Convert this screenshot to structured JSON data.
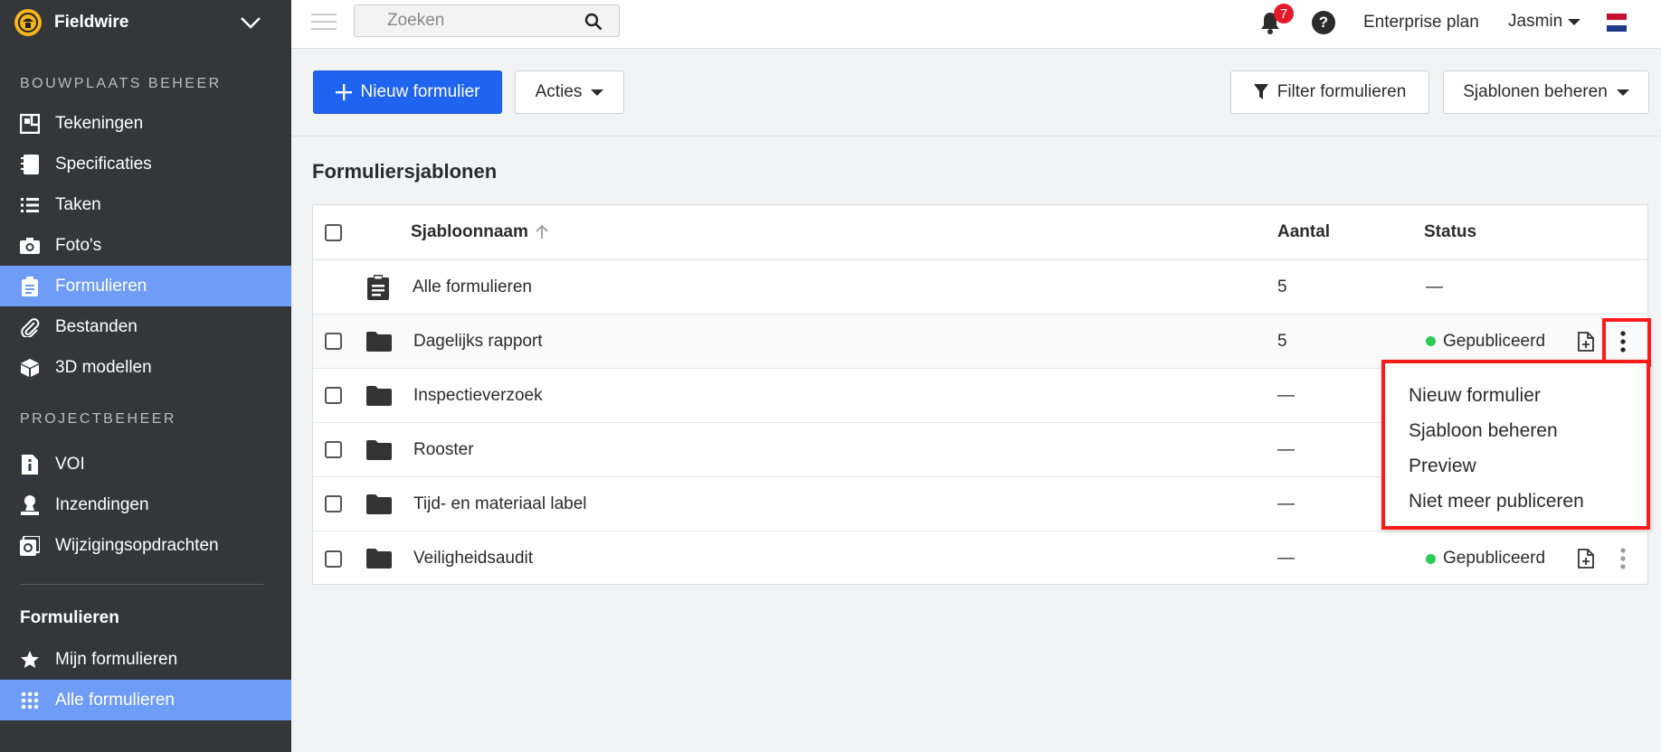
{
  "sidebar": {
    "brand": "Fieldwire",
    "section1_title": "BOUWPLAATS BEHEER",
    "section1_items": [
      {
        "label": "Tekeningen",
        "icon": "drawings-icon"
      },
      {
        "label": "Specificaties",
        "icon": "specs-icon"
      },
      {
        "label": "Taken",
        "icon": "tasks-list-icon"
      },
      {
        "label": "Foto's",
        "icon": "camera-icon"
      },
      {
        "label": "Formulieren",
        "icon": "clipboard-icon",
        "active": true
      },
      {
        "label": "Bestanden",
        "icon": "paperclip-icon"
      },
      {
        "label": "3D modellen",
        "icon": "cube-icon"
      }
    ],
    "section2_title": "PROJECTBEHEER",
    "section2_items": [
      {
        "label": "VOI",
        "icon": "rfi-file-icon"
      },
      {
        "label": "Inzendingen",
        "icon": "submittal-icon"
      },
      {
        "label": "Wijzigingsopdrachten",
        "icon": "change-order-icon"
      }
    ],
    "sub_title": "Formulieren",
    "sub_items": [
      {
        "label": "Mijn formulieren",
        "icon": "star-icon"
      },
      {
        "label": "Alle formulieren",
        "icon": "grid-dots-icon",
        "active": true
      }
    ]
  },
  "topbar": {
    "search_placeholder": "Zoeken",
    "notification_count": "7",
    "help_label": "?",
    "plan": "Enterprise plan",
    "user": "Jasmin"
  },
  "toolbar": {
    "new_form": "Nieuw formulier",
    "actions": "Acties",
    "filter": "Filter formulieren",
    "manage_templates": "Sjablonen beheren"
  },
  "main": {
    "title": "Formuliersjablonen",
    "columns": {
      "name": "Sjabloonnaam",
      "count": "Aantal",
      "status": "Status"
    },
    "rows": [
      {
        "name": "Alle formulieren",
        "count": "5",
        "status": "—",
        "type": "all"
      },
      {
        "name": "Dagelijks rapport",
        "count": "5",
        "status": "Gepubliceerd",
        "type": "folder"
      },
      {
        "name": "Inspectieverzoek",
        "count": "—",
        "status": "",
        "type": "folder"
      },
      {
        "name": "Rooster",
        "count": "—",
        "status": "",
        "type": "folder"
      },
      {
        "name": "Tijd- en materiaal label",
        "count": "—",
        "status": "",
        "type": "folder"
      },
      {
        "name": "Veiligheidsaudit",
        "count": "—",
        "status": "Gepubliceerd",
        "type": "folder"
      }
    ]
  },
  "dropdown": {
    "items": [
      "Nieuw formulier",
      "Sjabloon beheren",
      "Preview",
      "Niet meer publiceren"
    ]
  },
  "colors": {
    "sidebar_bg": "#34363a",
    "sidebar_active": "#6e9cf7",
    "primary": "#1e64f0",
    "published": "#2ecc55",
    "highlight": "#ff1a1a",
    "badge": "#e4192a"
  }
}
